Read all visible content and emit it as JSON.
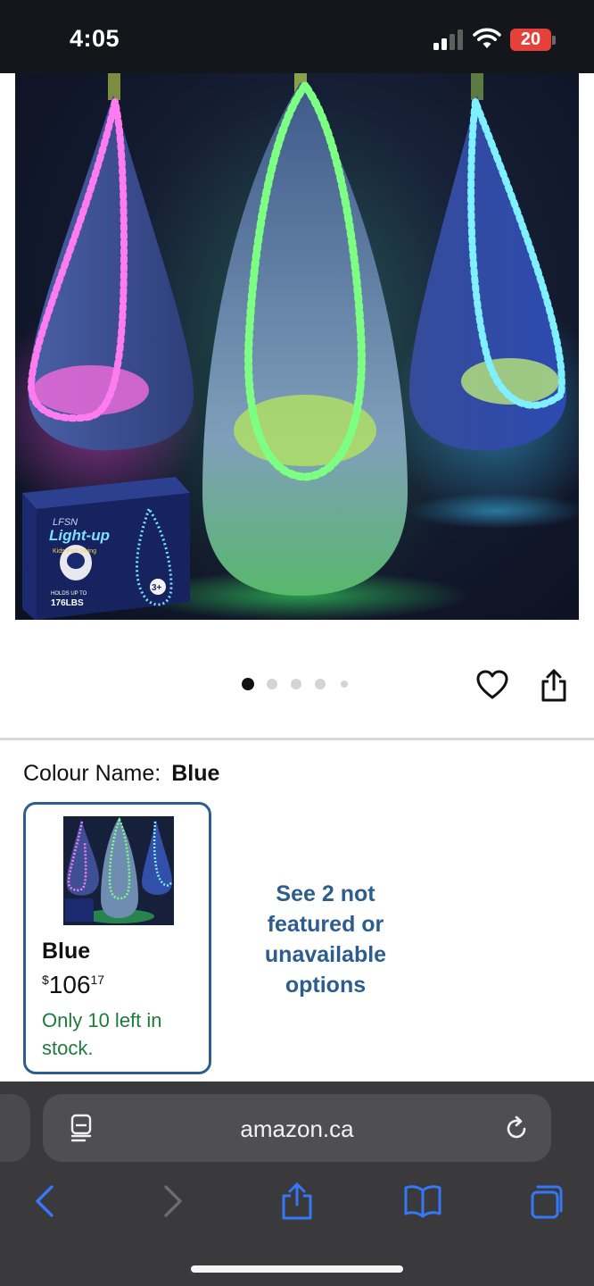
{
  "status_bar": {
    "time": "4:05",
    "battery": "20"
  },
  "product": {
    "box_brand": "LFSN",
    "box_title": "Light-up",
    "box_subtitle": "Kids Pod Swing",
    "box_capacity_line1": "HOLDS UP TO",
    "box_capacity_line2": "176LBS",
    "box_age": "3+"
  },
  "carousel": {
    "total": 5,
    "active": 0
  },
  "colour": {
    "label": "Colour Name:",
    "value": "Blue"
  },
  "swatch": {
    "name": "Blue",
    "currency": "$",
    "price_whole": "106",
    "price_fraction": "17",
    "stock": "Only 10 left in stock."
  },
  "see_more": "See 2 not featured or unavailable options",
  "browser": {
    "url": "amazon.ca"
  },
  "colors": {
    "link": "#2d5d8e",
    "stock": "#1e7b3c",
    "swatch_border": "#2e5e8e",
    "pink_led": "#ff5cf0",
    "green_led": "#6dff7a",
    "blue_led": "#6fe9ff",
    "ios_blue": "#3478f6"
  }
}
